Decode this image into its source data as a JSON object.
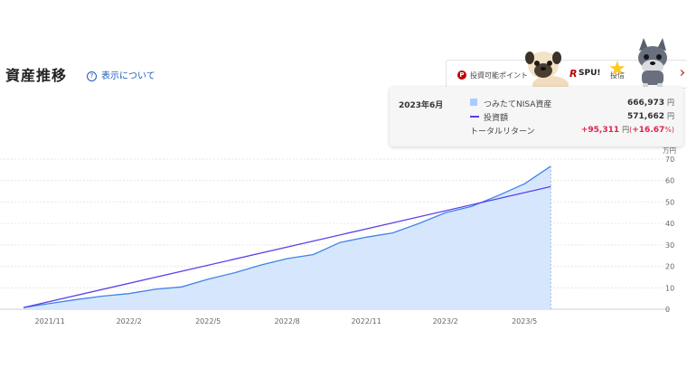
{
  "header": {
    "title": "資産推移",
    "help_label": "表示について"
  },
  "promo": {
    "point_label": "投資可能ポイント",
    "spu_label": "SPU!",
    "spu_detail": "投信",
    "p_icon_glyph": "P",
    "r_logo_glyph": "R"
  },
  "tooltip": {
    "month": "2023年6月",
    "asset_label": "つみたてNISA資産",
    "asset_value": "666,973",
    "invest_label": "投資額",
    "invest_value": "571,662",
    "return_label": "トータルリターン",
    "return_value": "+95,311",
    "return_pct": "+16.67",
    "currency": "円",
    "paren_open": "(",
    "paren_close": "%)",
    "asset_color": "#a9cbff",
    "invest_color": "#5a3fe8",
    "return_color": "#e0234a"
  },
  "chart_data": {
    "type": "area",
    "y_unit_label": "万円",
    "yticks": [
      0,
      10,
      20,
      30,
      40,
      50,
      60,
      70
    ],
    "ylim": [
      0,
      70
    ],
    "xlim": [
      0,
      24
    ],
    "grid": true,
    "xtick_positions": [
      1,
      4,
      7,
      10,
      13,
      16,
      19
    ],
    "xtick_labels": [
      "2021/11",
      "2022/2",
      "2022/5",
      "2022/8",
      "2022/11",
      "2023/2",
      "2023/5"
    ],
    "series": [
      {
        "name": "つみたてNISA資産",
        "kind": "area",
        "color": "#3f83e8",
        "fill": "#cfe3fd",
        "x": [
          0,
          1,
          2,
          3,
          4,
          5,
          6,
          7,
          8,
          9,
          10,
          11,
          12,
          13,
          14,
          15,
          16,
          17,
          18,
          19,
          20
        ],
        "values": [
          0.8,
          2.7,
          4.5,
          6.1,
          7.3,
          9.3,
          10.4,
          14.0,
          17.0,
          20.6,
          23.6,
          25.5,
          31.1,
          33.6,
          35.6,
          40.0,
          45.0,
          48.0,
          53.0,
          58.5,
          66.7
        ]
      },
      {
        "name": "投資額",
        "kind": "line",
        "color": "#5a3fe8",
        "x": [
          0,
          20
        ],
        "values": [
          0.8,
          57.2
        ]
      }
    ]
  }
}
